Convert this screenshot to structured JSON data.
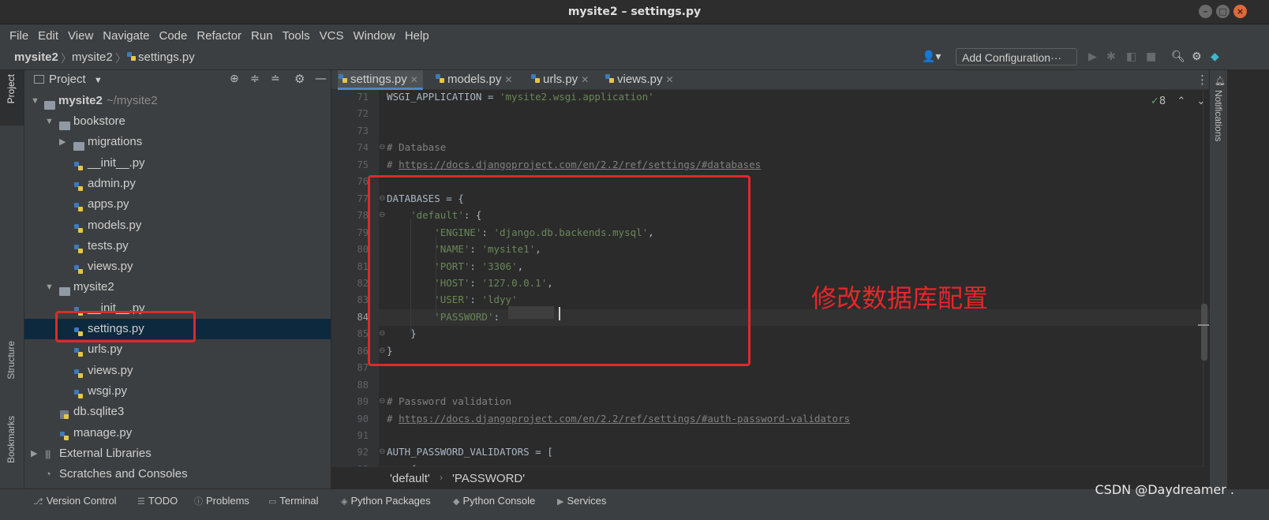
{
  "window": {
    "title": "mysite2 – settings.py"
  },
  "menu": [
    "File",
    "Edit",
    "View",
    "Navigate",
    "Code",
    "Refactor",
    "Run",
    "Tools",
    "VCS",
    "Window",
    "Help"
  ],
  "breadcrumb": {
    "root": "mysite2",
    "folder": "mysite2",
    "file": "settings.py"
  },
  "toolbar": {
    "add_config": "Add Configuration···"
  },
  "left_strip": {
    "project": "Project",
    "structure": "Structure",
    "bookmarks": "Bookmarks"
  },
  "right_strip": {
    "notifications": "Notifications"
  },
  "project_panel": {
    "title": "Project",
    "root_name": "mysite2",
    "root_path": "~/mysite2",
    "items": [
      {
        "label": "bookstore",
        "kind": "folder",
        "indent": 1,
        "arrow": "down"
      },
      {
        "label": "migrations",
        "kind": "folder",
        "indent": 2,
        "arrow": "right"
      },
      {
        "label": "__init__.py",
        "kind": "py",
        "indent": 2
      },
      {
        "label": "admin.py",
        "kind": "py",
        "indent": 2
      },
      {
        "label": "apps.py",
        "kind": "py",
        "indent": 2
      },
      {
        "label": "models.py",
        "kind": "py",
        "indent": 2
      },
      {
        "label": "tests.py",
        "kind": "py",
        "indent": 2
      },
      {
        "label": "views.py",
        "kind": "py",
        "indent": 2
      },
      {
        "label": "mysite2",
        "kind": "folder",
        "indent": 1,
        "arrow": "down"
      },
      {
        "label": "__init__.py",
        "kind": "py",
        "indent": 2
      },
      {
        "label": "settings.py",
        "kind": "py",
        "indent": 2,
        "selected": true
      },
      {
        "label": "urls.py",
        "kind": "py",
        "indent": 2
      },
      {
        "label": "views.py",
        "kind": "py",
        "indent": 2
      },
      {
        "label": "wsgi.py",
        "kind": "py",
        "indent": 2
      },
      {
        "label": "db.sqlite3",
        "kind": "db",
        "indent": 1
      },
      {
        "label": "manage.py",
        "kind": "py",
        "indent": 1
      },
      {
        "label": "External Libraries",
        "kind": "lib",
        "indent": 0,
        "arrow": "right"
      },
      {
        "label": "Scratches and Consoles",
        "kind": "scratch",
        "indent": 0
      }
    ]
  },
  "tabs": [
    {
      "label": "settings.py",
      "active": true
    },
    {
      "label": "models.py"
    },
    {
      "label": "urls.py"
    },
    {
      "label": "views.py"
    }
  ],
  "inspection": {
    "count": "8"
  },
  "editor": {
    "lines": [
      {
        "n": "71",
        "parts": [
          [
            "p",
            "WSGI_APPLICATION = "
          ],
          [
            "s",
            "'mysite2.wsgi.application'"
          ]
        ]
      },
      {
        "n": "72",
        "parts": []
      },
      {
        "n": "73",
        "parts": []
      },
      {
        "n": "74",
        "parts": [
          [
            "c",
            "# Database"
          ]
        ]
      },
      {
        "n": "75",
        "parts": [
          [
            "c",
            "# "
          ],
          [
            "u",
            "https://docs.djangoproject.com/en/2.2/ref/settings/#databases"
          ]
        ]
      },
      {
        "n": "76",
        "parts": []
      },
      {
        "n": "77",
        "parts": [
          [
            "p",
            "DATABASES = {"
          ]
        ]
      },
      {
        "n": "78",
        "parts": [
          [
            "p",
            "    "
          ],
          [
            "s",
            "'default'"
          ],
          [
            "p",
            ": {"
          ]
        ]
      },
      {
        "n": "79",
        "parts": [
          [
            "p",
            "        "
          ],
          [
            "s",
            "'ENGINE'"
          ],
          [
            "p",
            ": "
          ],
          [
            "s",
            "'django.db.backends.mysql'"
          ],
          [
            "p",
            ","
          ]
        ]
      },
      {
        "n": "80",
        "parts": [
          [
            "p",
            "        "
          ],
          [
            "s",
            "'NAME'"
          ],
          [
            "p",
            ": "
          ],
          [
            "s",
            "'mysite1'"
          ],
          [
            "p",
            ","
          ]
        ]
      },
      {
        "n": "81",
        "parts": [
          [
            "p",
            "        "
          ],
          [
            "s",
            "'PORT'"
          ],
          [
            "p",
            ": "
          ],
          [
            "s",
            "'3306'"
          ],
          [
            "p",
            ","
          ]
        ]
      },
      {
        "n": "82",
        "parts": [
          [
            "p",
            "        "
          ],
          [
            "s",
            "'HOST'"
          ],
          [
            "p",
            ": "
          ],
          [
            "s",
            "'127.0.0.1'"
          ],
          [
            "p",
            ","
          ]
        ]
      },
      {
        "n": "83",
        "parts": [
          [
            "p",
            "        "
          ],
          [
            "s",
            "'USER'"
          ],
          [
            "p",
            ": "
          ],
          [
            "s",
            "'ldyy'"
          ]
        ]
      },
      {
        "n": "84",
        "parts": [
          [
            "p",
            "        "
          ],
          [
            "s",
            "'PASSWORD'"
          ],
          [
            "p",
            ":"
          ]
        ],
        "current": true
      },
      {
        "n": "85",
        "parts": [
          [
            "p",
            "    }"
          ]
        ]
      },
      {
        "n": "86",
        "parts": [
          [
            "p",
            "}"
          ]
        ]
      },
      {
        "n": "87",
        "parts": []
      },
      {
        "n": "88",
        "parts": []
      },
      {
        "n": "89",
        "parts": [
          [
            "c",
            "# Password validation"
          ]
        ]
      },
      {
        "n": "90",
        "parts": [
          [
            "c",
            "# "
          ],
          [
            "u",
            "https://docs.djangoproject.com/en/2.2/ref/settings/#auth-password-validators"
          ]
        ]
      },
      {
        "n": "91",
        "parts": []
      },
      {
        "n": "92",
        "parts": [
          [
            "p",
            "AUTH_PASSWORD_VALIDATORS = ["
          ]
        ]
      },
      {
        "n": "93",
        "parts": [
          [
            "p",
            "    {"
          ]
        ]
      }
    ]
  },
  "annotation": {
    "text": "修改数据库配置"
  },
  "editor_breadcrumb": {
    "first": "'default'",
    "second": "'PASSWORD'"
  },
  "statusbar": [
    "Version Control",
    "TODO",
    "Problems",
    "Terminal",
    "Python Packages",
    "Python Console",
    "Services"
  ],
  "watermark": "CSDN @Daydreamer ."
}
